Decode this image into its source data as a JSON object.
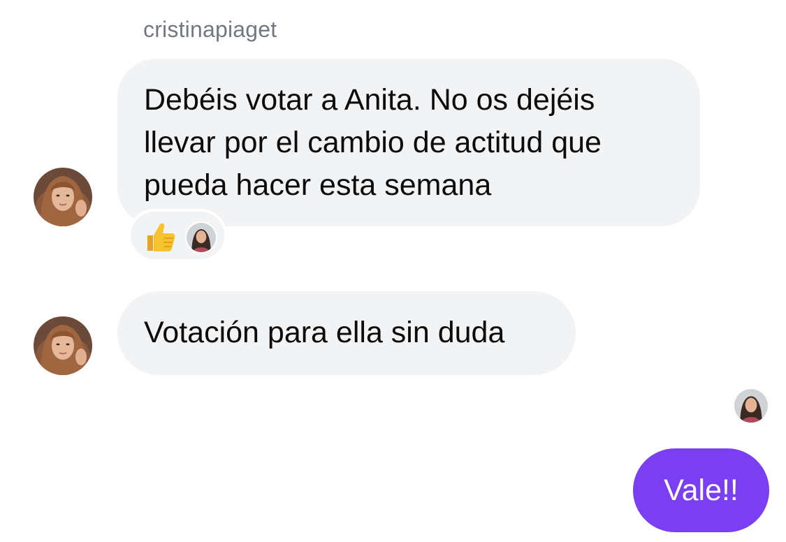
{
  "conversation": {
    "sender_name": "cristinapiaget",
    "messages": [
      {
        "from": "cristinapiaget",
        "lines": [
          "Debéis votar a Anita. No os dejéis",
          "llevar por el cambio de actitud que",
          "pueda hacer esta semana"
        ],
        "reactions": [
          {
            "emoji": "thumbs-up-icon",
            "by_avatar": "reactor-avatar"
          }
        ]
      },
      {
        "from": "cristinapiaget",
        "text": "Votación para ella sin duda"
      },
      {
        "from": "me",
        "text": "Vale!!"
      }
    ]
  },
  "colors": {
    "incoming_bubble": "#f2f3f5",
    "outgoing_bubble": "#7b3ff2",
    "sender_name": "#737880",
    "text": "#0c0c0d"
  }
}
